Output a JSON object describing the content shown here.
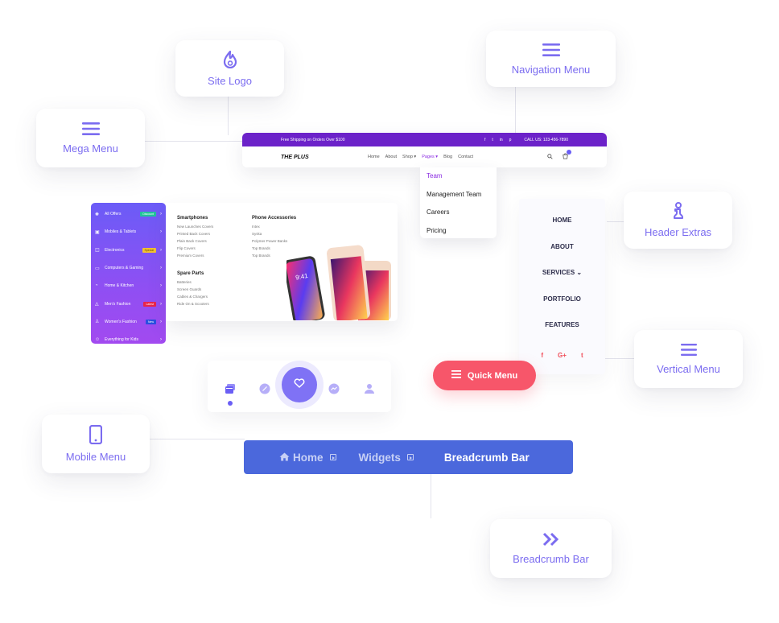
{
  "feature_cards": {
    "site_logo": {
      "label": "Site Logo",
      "icon": "flame-icon"
    },
    "navigation_menu": {
      "label": "Navigation Menu",
      "icon": "hamburger-icon"
    },
    "mega_menu": {
      "label": "Mega Menu",
      "icon": "hamburger-icon"
    },
    "header_extras": {
      "label": "Header Extras",
      "icon": "info-icon"
    },
    "vertical_menu": {
      "label": "Vertical Menu",
      "icon": "hamburger-icon"
    },
    "mobile_menu": {
      "label": "Mobile Menu",
      "icon": "smartphone-icon"
    },
    "breadcrumb_bar": {
      "label": "Breadcrumb Bar",
      "icon": "double-chevron-right-icon"
    }
  },
  "header_mock": {
    "topbar": {
      "shipping_text": "Free Shipping on Orders Over $100",
      "socials": [
        "f",
        "t",
        "in",
        "p"
      ],
      "phone": "CALL US: 123-456-7890"
    },
    "logo": "THE PLUS",
    "nav": [
      "Home",
      "About",
      "Shop ▾",
      "Pages ▾",
      "Blog",
      "Contact"
    ],
    "active_nav": "Pages ▾",
    "cart_count": "1",
    "dropdown": [
      "Team",
      "Management Team",
      "Careers",
      "Pricing"
    ],
    "dropdown_active": "Team"
  },
  "mega_menu": {
    "sidebar": [
      {
        "icon": "✺",
        "label": "All Offers",
        "badge": "Discount",
        "badge_color": "#22c39a"
      },
      {
        "icon": "▣",
        "label": "Mobiles & Tablets",
        "badge": "",
        "badge_color": ""
      },
      {
        "icon": "◫",
        "label": "Electronics",
        "badge": "Special",
        "badge_color": "#f2c230"
      },
      {
        "icon": "▭",
        "label": "Computers & Gaming",
        "badge": "",
        "badge_color": ""
      },
      {
        "icon": "◔",
        "label": "Home & Kitchen",
        "badge": "",
        "badge_color": ""
      },
      {
        "icon": "◬",
        "label": "Men's Fashion",
        "badge": "Latest",
        "badge_color": "#e8254a"
      },
      {
        "icon": "♙",
        "label": "Women's Fashion",
        "badge": "New",
        "badge_color": "#2a4fe0"
      },
      {
        "icon": "☺",
        "label": "Everything for Kids",
        "badge": "",
        "badge_color": ""
      }
    ],
    "columns": [
      {
        "title": "Smartphones",
        "items": [
          "New Launches Covers",
          "Printed Back Covers",
          "Plain Back Covers",
          "Flip Covers",
          "Premium Covers"
        ]
      },
      {
        "title": "Phone Accessories",
        "items": [
          "Intex",
          "Syska",
          "Polymer Power Banks",
          "Top Brands",
          "Top Brands"
        ]
      },
      {
        "title": "Spare Parts",
        "items": [
          "Batteries",
          "Screen Guards",
          "Cables & Chargers",
          "Ride On & Scooters"
        ]
      }
    ],
    "phone_screen_time": "9:41"
  },
  "vertical_menu": {
    "items": [
      "HOME",
      "ABOUT",
      "SERVICES ⌄",
      "PORTFOLIO",
      "FEATURES"
    ],
    "socials": [
      "f",
      "G+",
      "t"
    ]
  },
  "quick_menu": {
    "label": "Quick Menu"
  },
  "mobile_bar": {
    "icons": [
      "cards-icon",
      "compass-icon",
      "heart-icon",
      "messenger-icon",
      "user-icon"
    ],
    "active_index": 0
  },
  "breadcrumb": {
    "items": [
      "Home",
      "Widgets",
      "Breadcrumb Bar"
    ],
    "current": "Breadcrumb Bar"
  },
  "colors": {
    "accent": "#7b6cf0",
    "topbar": "#6c22c9",
    "quick_menu": "#f7566a",
    "breadcrumb_bg": "#4b68dc"
  }
}
